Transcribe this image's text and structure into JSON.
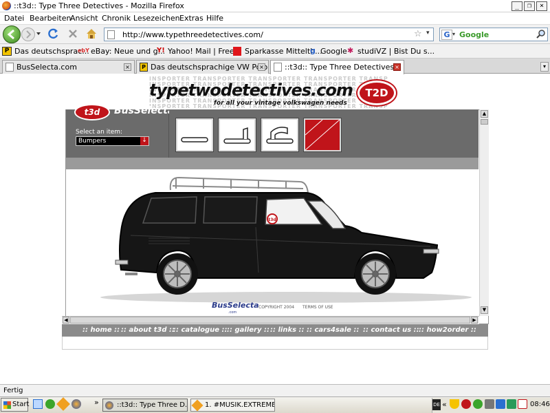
{
  "window": {
    "title": "::t3d:: Type Three Detectives - Mozilla Firefox"
  },
  "menu": [
    "Datei",
    "Bearbeiten",
    "Ansicht",
    "Chronik",
    "Lesezeichen",
    "Extras",
    "Hilfe"
  ],
  "nav": {
    "url": "http://www.typethreedetectives.com/",
    "search_engine": "Google"
  },
  "bookmarks": [
    {
      "label": "Das deutschsprac..."
    },
    {
      "label": "eBay: Neue und g..."
    },
    {
      "label": "Yahoo! Mail | Free..."
    },
    {
      "label": "Sparkasse Mittelth..."
    },
    {
      "label": "Google"
    },
    {
      "label": "studiVZ | Bist Du s..."
    }
  ],
  "tabs": [
    {
      "label": "BusSelecta.com"
    },
    {
      "label": "Das deutschsprachige VW Polo P..."
    },
    {
      "label": "::t3d:: Type Three Detectives"
    }
  ],
  "page": {
    "banner_title": "typetwodetectives.com",
    "banner_subtitle": "for all your vintage volkswagen needs",
    "banner_bg": "INSPORTER TRANSPORTER TRANSPORTER TRANSPORTER TRANSP",
    "banner_badge": "T2D",
    "logo_text": "t3d",
    "logo_selecta": "BusSelecta",
    "select_label": "Select an item:",
    "select_value": "Bumpers",
    "footer_logo": "BusSelecta",
    "footer_logo_sub": ".com",
    "footer_copyright": "COPYRIGHT 2004",
    "footer_terms": "TERMS OF USE",
    "plate_text": "t3d",
    "nav_links": [
      ":: home ::",
      ":: about t3d ::",
      ":: catalogue ::",
      ":: gallery ::",
      ":: links ::",
      ":: cars4sale ::",
      ":: contact us ::",
      ":: how2order ::"
    ]
  },
  "status": {
    "text": "Fertig"
  },
  "taskbar": {
    "start": "Start",
    "tasks": [
      {
        "label": "::t3d:: Type Three D..."
      },
      {
        "label": "1. #MUSIK.EXTREME - ..."
      }
    ],
    "tray_chevron": "«",
    "tray_badge": "DE",
    "clock": "08:46",
    "quick_chevron": "»"
  },
  "colors": {
    "accent_red": "#c0141a",
    "panel_grey": "#6b6b6b",
    "nav_grey": "#8b8b8b",
    "car_black": "#161616"
  }
}
